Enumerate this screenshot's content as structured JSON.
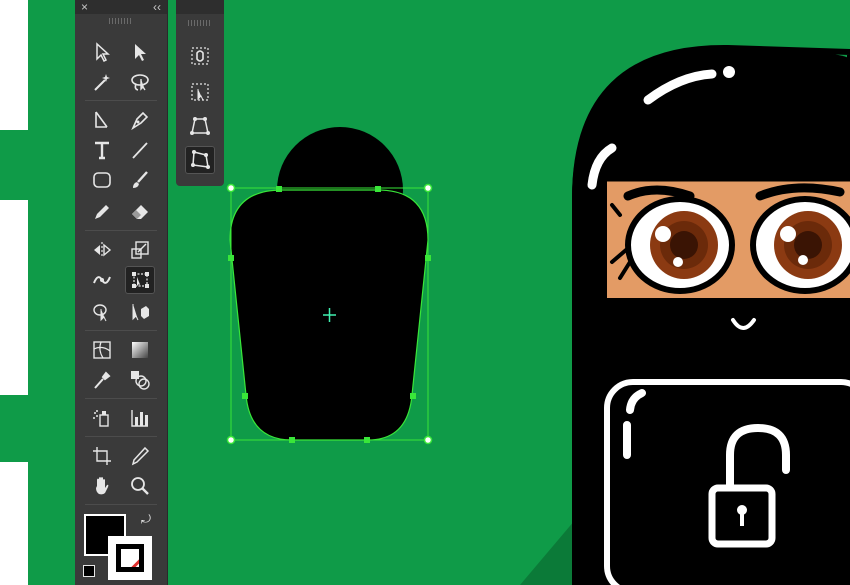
{
  "colors": {
    "canvas_bg": "#0f9b48",
    "panel_bg": "#3a3a3a",
    "selection": "#39e639",
    "skin": "#e39b65",
    "iris": "#8b3a12"
  },
  "toolbar": {
    "close_glyph": "×",
    "collapse_glyph": "‹‹",
    "tools": [
      "selection-tool",
      "direct-selection-tool",
      "magic-wand-tool",
      "lasso-tool",
      "line-segment-tool",
      "pen-tool",
      "type-tool",
      "line-tool",
      "rectangle-tool",
      "paintbrush-tool",
      "pencil-tool",
      "eraser-tool",
      "reflect-tool",
      "scale-tool",
      "width-tool",
      "free-transform-tool",
      "shape-builder-tool",
      "perspective-grid-tool",
      "mesh-tool",
      "gradient-tool",
      "eyedropper-tool",
      "blend-tool",
      "symbol-sprayer-tool",
      "column-graph-tool",
      "artboard-tool",
      "slice-tool",
      "hand-tool",
      "zoom-tool"
    ],
    "active_tool": "free-transform-tool",
    "fill_color": "#000000",
    "stroke_color": "none"
  },
  "flyout": {
    "tools": [
      "constrain-icon",
      "free-transform-icon",
      "perspective-distort-icon",
      "free-distort-icon"
    ],
    "active_tool": "free-distort-icon"
  }
}
